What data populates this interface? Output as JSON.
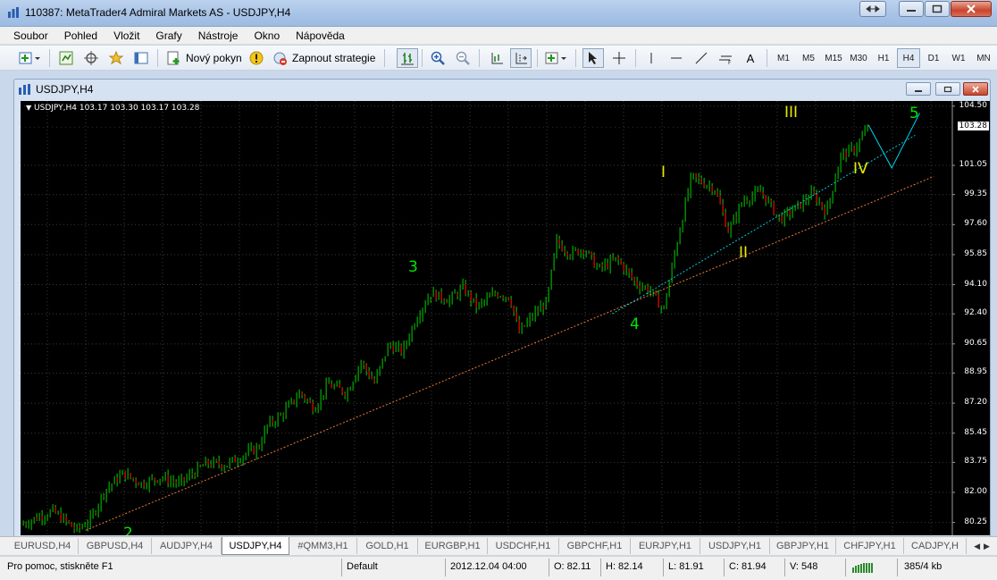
{
  "window": {
    "title": "110387: MetaTrader4 Admiral Markets AS - USDJPY,H4"
  },
  "menu": [
    "Soubor",
    "Pohled",
    "Vložit",
    "Grafy",
    "Nástroje",
    "Okno",
    "Nápověda"
  ],
  "toolbar": {
    "new_order": "Nový pokyn",
    "enable_strategies": "Zapnout strategie",
    "text_tool": "A",
    "timeframes": [
      "M1",
      "M5",
      "M15",
      "M30",
      "H1",
      "H4",
      "D1",
      "W1",
      "MN"
    ],
    "active_timeframe": "H4"
  },
  "chart_window": {
    "title": "USDJPY,H4",
    "header": "USDJPY,H4  103.17 103.30 103.17 103.28"
  },
  "chart_data": {
    "type": "candlestick",
    "symbol": "USDJPY",
    "timeframe": "H4",
    "ohlc_last": {
      "open": 103.17,
      "high": 103.3,
      "low": 103.17,
      "close": 103.28
    },
    "current_price": "103.28",
    "y_ticks": [
      "104.50",
      "101.05",
      "99.35",
      "97.60",
      "95.85",
      "94.10",
      "92.40",
      "90.65",
      "88.95",
      "87.20",
      "85.45",
      "83.75",
      "82.00",
      "80.25"
    ],
    "ylim": [
      79.5,
      104.8
    ],
    "price_path": [
      [
        0,
        80.1
      ],
      [
        0.02,
        80.6
      ],
      [
        0.035,
        80.9
      ],
      [
        0.06,
        79.8
      ],
      [
        0.075,
        80.4
      ],
      [
        0.09,
        82.1
      ],
      [
        0.11,
        83.1
      ],
      [
        0.13,
        82.5
      ],
      [
        0.15,
        82.9
      ],
      [
        0.17,
        82.5
      ],
      [
        0.185,
        83.1
      ],
      [
        0.2,
        83.7
      ],
      [
        0.22,
        83.6
      ],
      [
        0.24,
        84.2
      ],
      [
        0.255,
        84.6
      ],
      [
        0.265,
        85.9
      ],
      [
        0.28,
        86.5
      ],
      [
        0.3,
        87.8
      ],
      [
        0.315,
        86.9
      ],
      [
        0.33,
        88.3
      ],
      [
        0.35,
        87.8
      ],
      [
        0.365,
        89.6
      ],
      [
        0.38,
        88.4
      ],
      [
        0.395,
        90.6
      ],
      [
        0.41,
        90.2
      ],
      [
        0.425,
        92.2
      ],
      [
        0.44,
        93.6
      ],
      [
        0.46,
        93.2
      ],
      [
        0.475,
        93.9
      ],
      [
        0.49,
        92.8
      ],
      [
        0.51,
        93.6
      ],
      [
        0.525,
        93.4
      ],
      [
        0.535,
        91.3
      ],
      [
        0.55,
        92.3
      ],
      [
        0.565,
        93.1
      ],
      [
        0.575,
        96.6
      ],
      [
        0.59,
        95.9
      ],
      [
        0.605,
        96.2
      ],
      [
        0.62,
        95.0
      ],
      [
        0.64,
        95.6
      ],
      [
        0.66,
        94.2
      ],
      [
        0.675,
        93.8
      ],
      [
        0.69,
        92.6
      ],
      [
        0.705,
        96.7
      ],
      [
        0.72,
        100.4
      ],
      [
        0.745,
        99.7
      ],
      [
        0.76,
        97.2
      ],
      [
        0.775,
        99.0
      ],
      [
        0.795,
        99.5
      ],
      [
        0.815,
        97.9
      ],
      [
        0.835,
        98.7
      ],
      [
        0.85,
        99.4
      ],
      [
        0.865,
        98.3
      ],
      [
        0.88,
        101.6
      ],
      [
        0.895,
        102.0
      ],
      [
        0.91,
        103.3
      ]
    ],
    "annotations": [
      {
        "text": "2",
        "color": "green"
      },
      {
        "text": "3",
        "color": "green"
      },
      {
        "text": "4",
        "color": "green"
      },
      {
        "text": "5",
        "color": "green"
      },
      {
        "text": "I",
        "color": "yellow"
      },
      {
        "text": "II",
        "color": "yellow"
      },
      {
        "text": "III",
        "color": "yellow"
      },
      {
        "text": "IV",
        "color": "yellow"
      }
    ],
    "trendlines": [
      {
        "from": [
          0.07,
          79.8
        ],
        "to": [
          0.98,
          100.4
        ],
        "color": "#e87a3a",
        "style": "dotted"
      },
      {
        "from": [
          0.635,
          92.4
        ],
        "to": [
          0.96,
          102.8
        ],
        "color": "#00c8e0",
        "style": "dotted"
      }
    ],
    "projection": [
      [
        0.91,
        103.4
      ],
      [
        0.935,
        100.9
      ],
      [
        0.965,
        104.1
      ]
    ],
    "colors": {
      "background": "#000000",
      "candles": "#00d000",
      "grid": "#3a3a3a"
    }
  },
  "tabs": [
    "EURUSD,H4",
    "GBPUSD,H4",
    "AUDJPY,H4",
    "USDJPY,H4",
    "#QMM3,H1",
    "GOLD,H1",
    "EURGBP,H1",
    "USDCHF,H1",
    "GBPCHF,H1",
    "EURJPY,H1",
    "USDJPY,H1",
    "GBPJPY,H1",
    "CHFJPY,H1",
    "CADJPY,H"
  ],
  "active_tab": "USDJPY,H4",
  "status": {
    "help": "Pro pomoc, stiskněte F1",
    "profile": "Default",
    "datetime": "2012.12.04 04:00",
    "open": "O: 82.11",
    "high": "H: 82.14",
    "low": "L: 81.91",
    "close": "C: 81.94",
    "volume": "V: 548",
    "traffic": "385/4 kb"
  }
}
